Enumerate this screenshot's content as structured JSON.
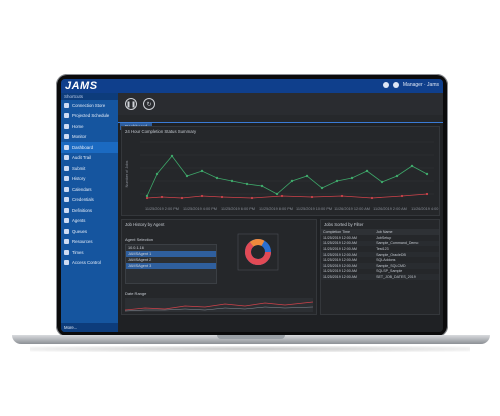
{
  "app": {
    "logo": "JAMS",
    "header_right": "Manager · Jams"
  },
  "sidebar": {
    "header": "Shortcuts",
    "items": [
      {
        "label": "Connection Store",
        "icon": "connection-icon"
      },
      {
        "label": "Projected Schedule",
        "icon": "schedule-icon"
      },
      {
        "label": "Home",
        "icon": "home-icon"
      },
      {
        "label": "Monitor",
        "icon": "monitor-icon"
      },
      {
        "label": "Dashboard",
        "icon": "dashboard-icon"
      },
      {
        "label": "Audit Trail",
        "icon": "audit-icon"
      },
      {
        "label": "Submit",
        "icon": "submit-icon"
      },
      {
        "label": "History",
        "icon": "history-icon"
      },
      {
        "label": "Calendars",
        "icon": "calendar-icon"
      },
      {
        "label": "Credentials",
        "icon": "credentials-icon"
      },
      {
        "label": "Definitions",
        "icon": "definitions-icon"
      },
      {
        "label": "Agents",
        "icon": "agents-icon"
      },
      {
        "label": "Queues",
        "icon": "queues-icon"
      },
      {
        "label": "Resources",
        "icon": "resources-icon"
      },
      {
        "label": "Times",
        "icon": "times-icon"
      },
      {
        "label": "Access Control",
        "icon": "access-icon"
      }
    ],
    "more": "More..."
  },
  "main": {
    "tab": "Dashboard",
    "summary_title": "24 Hour Completion Status Summary",
    "ylabel": "Number of Jobs",
    "xticks": [
      "11/25/2019 2:00 PM",
      "11/25/2019 4:00 PM",
      "11/25/2019 6:00 PM",
      "11/25/2019 8:00 PM",
      "11/25/2019 10:00 PM",
      "11/26/2019 12:00 AM",
      "11/26/2019 2:00 AM",
      "11/26/2019 4:00 AM"
    ],
    "agent_history_title": "Job History by Agent",
    "agent_selection_label": "Agent Selection",
    "agents": [
      "10.0.1.16",
      "JAMSAgent 1",
      "JAMSAgent 2",
      "JAMSAgent 3"
    ],
    "date_range_label": "Date Range",
    "jobs_title": "Jobs Sorted by Filter",
    "jobs_headers": [
      "Completion Time",
      "Job Name"
    ],
    "jobs": [
      [
        "11/25/2019 12:00 AM",
        "JobSetup"
      ],
      [
        "11/25/2019 12:00 AM",
        "Sample_Command_Demo"
      ],
      [
        "11/25/2019 12:00 AM",
        "Test123"
      ],
      [
        "11/25/2019 12:00 AM",
        "Sample_OracleDB"
      ],
      [
        "11/25/2019 12:00 AM",
        "SQLAddons"
      ],
      [
        "11/25/2019 12:00 AM",
        "Sample_SQLCMD"
      ],
      [
        "11/25/2019 12:00 AM",
        "SQLSP_Sample"
      ],
      [
        "11/25/2019 12:00 AM",
        "SET_JOB_DATES_2019"
      ]
    ]
  },
  "colors": {
    "brand": "#0f3f8c",
    "sidebar": "#15559f",
    "series_success": "#3ea86a",
    "series_failed": "#d0424a"
  }
}
